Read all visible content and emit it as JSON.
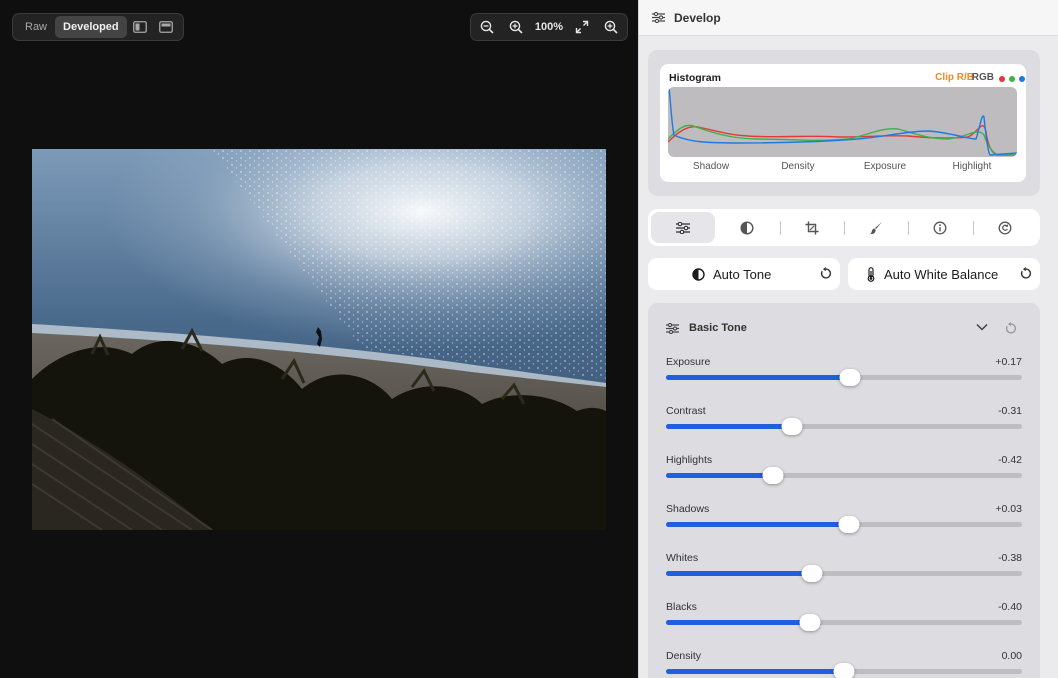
{
  "viewer": {
    "toggle": {
      "raw_label": "Raw",
      "developed_label": "Developed",
      "active": "Developed"
    },
    "zoom": {
      "value": "100%"
    }
  },
  "panel": {
    "header_title": "Develop",
    "histogram": {
      "title": "Histogram",
      "clip_label": "Clip R/B",
      "rgb_label": "RGB",
      "channel_colors": [
        "#e23a3a",
        "#3bb34a",
        "#1e7ae0"
      ],
      "axis_labels": [
        "Shadow",
        "Density",
        "Exposure",
        "Highlight"
      ]
    },
    "tool_tabs": [
      {
        "icon": "sliders-icon",
        "active": true
      },
      {
        "icon": "contrast-icon",
        "active": false
      },
      {
        "icon": "crop-icon",
        "active": false
      },
      {
        "icon": "brush-icon",
        "active": false
      },
      {
        "icon": "info-icon",
        "active": false
      },
      {
        "icon": "history-icon",
        "active": false
      }
    ],
    "auto_tone_label": "Auto Tone",
    "auto_wb_label": "Auto White Balance",
    "basic_tone": {
      "title": "Basic Tone",
      "sliders": [
        {
          "label": "Exposure",
          "value": "+0.17",
          "level": 0.518
        },
        {
          "label": "Contrast",
          "value": "-0.31",
          "level": 0.355
        },
        {
          "label": "Highlights",
          "value": "-0.42",
          "level": 0.3
        },
        {
          "label": "Shadows",
          "value": "+0.03",
          "level": 0.515
        },
        {
          "label": "Whites",
          "value": "-0.38",
          "level": 0.41
        },
        {
          "label": "Blacks",
          "value": "-0.40",
          "level": 0.405
        },
        {
          "label": "Density",
          "value": "0.00",
          "level": 0.5
        }
      ]
    }
  },
  "colors": {
    "accent": "#1f5fe0",
    "clip": "#f08a24"
  }
}
